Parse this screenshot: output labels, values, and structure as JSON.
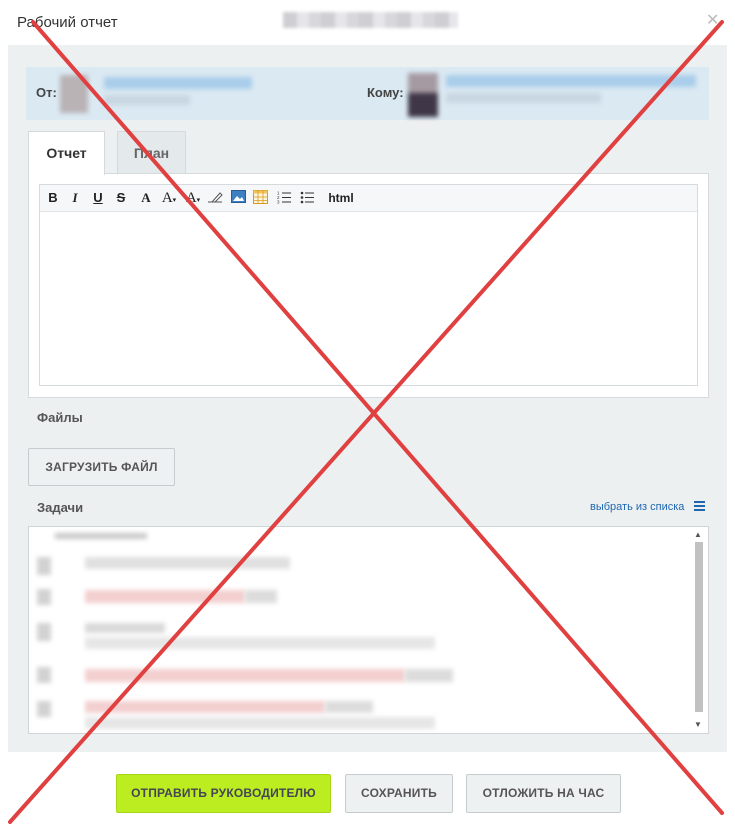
{
  "window": {
    "title": "Рабочий отчет",
    "close_icon": "close-icon"
  },
  "addressee": {
    "from_label": "От:",
    "to_label": "Кому:"
  },
  "tabs": [
    {
      "label": "Отчет",
      "active": true
    },
    {
      "label": "План",
      "active": false
    }
  ],
  "editor": {
    "toolbar": {
      "bold": "B",
      "italic": "I",
      "underline": "U",
      "strike": "S",
      "font_family": "A",
      "font_size": "A",
      "font_color": "A",
      "html": "html"
    }
  },
  "files": {
    "label": "Файлы",
    "upload_button": "ЗАГРУЗИТЬ ФАЙЛ"
  },
  "tasks": {
    "label": "Задачи",
    "select_link": "выбрать из списка"
  },
  "footer": {
    "send_button": "ОТПРАВИТЬ РУКОВОДИТЕЛЮ",
    "save_button": "СОХРАНИТЬ",
    "delay_button": "ОТЛОЖИТЬ НА ЧАС"
  },
  "colors": {
    "accent_green": "#bbed21",
    "link_blue": "#2067b0",
    "cross_red": "#e04040"
  }
}
